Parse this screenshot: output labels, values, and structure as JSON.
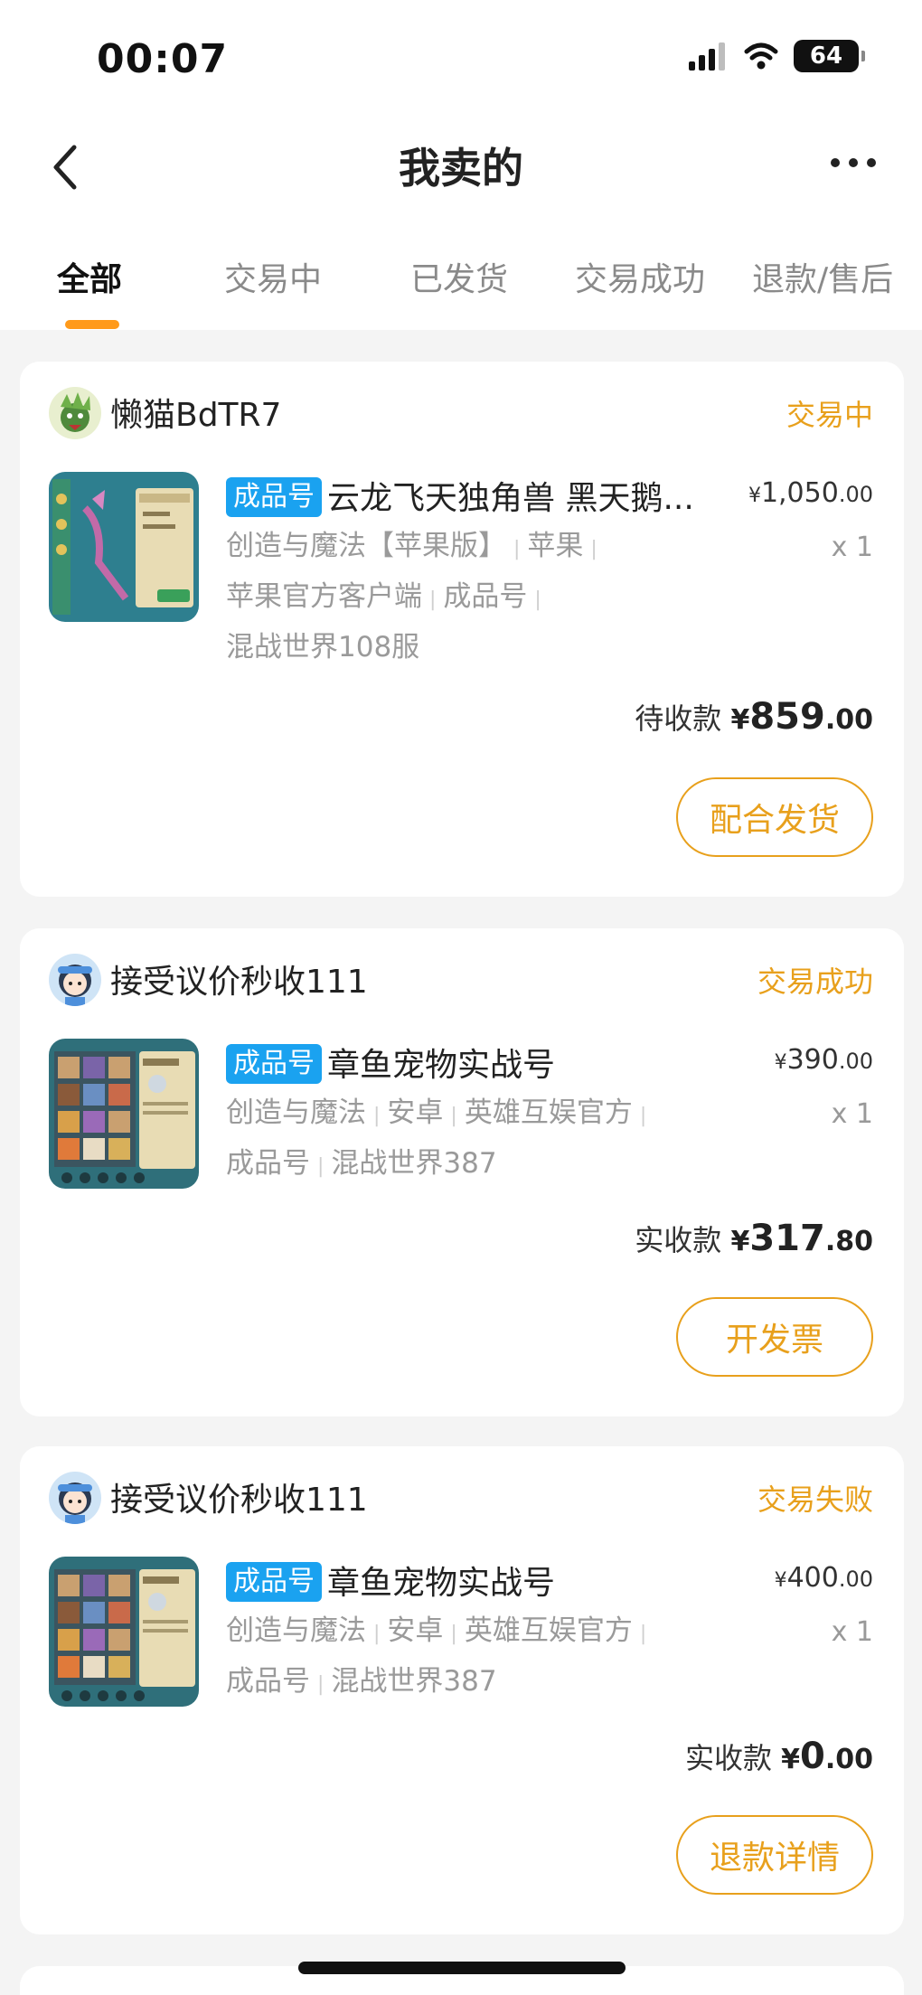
{
  "status_bar": {
    "time": "00:07",
    "battery": "64"
  },
  "nav": {
    "title": "我卖的"
  },
  "tabs": [
    {
      "label": "全部",
      "active": true
    },
    {
      "label": "交易中"
    },
    {
      "label": "已发货"
    },
    {
      "label": "交易成功"
    },
    {
      "label": "退款/售后"
    }
  ],
  "orders": [
    {
      "seller": "懒猫BdTR7",
      "status": "交易中",
      "badge": "成品号",
      "title": "云龙飞天独角兽 黑天鹅...",
      "price": {
        "currency": "¥",
        "int": "1,050",
        "dec": ".00"
      },
      "qty": "x 1",
      "desc": [
        "创造与魔法【苹果版】",
        "苹果",
        "苹果官方客户端",
        "成品号",
        "混战世界108服"
      ],
      "total_label": "待收款",
      "total": {
        "currency": "¥",
        "int": "859",
        "dec": ".00"
      },
      "action": "配合发货"
    },
    {
      "seller": "接受议价秒收111",
      "status": "交易成功",
      "badge": "成品号",
      "title": "章鱼宠物实战号",
      "price": {
        "currency": "¥",
        "int": "390",
        "dec": ".00"
      },
      "qty": "x 1",
      "desc": [
        "创造与魔法",
        "安卓",
        "英雄互娱官方",
        "成品号",
        "混战世界387"
      ],
      "total_label": "实收款",
      "total": {
        "currency": "¥",
        "int": "317",
        "dec": ".80"
      },
      "action": "开发票"
    },
    {
      "seller": "接受议价秒收111",
      "status": "交易失败",
      "badge": "成品号",
      "title": "章鱼宠物实战号",
      "price": {
        "currency": "¥",
        "int": "400",
        "dec": ".00"
      },
      "qty": "x 1",
      "desc": [
        "创造与魔法",
        "安卓",
        "英雄互娱官方",
        "成品号",
        "混战世界387"
      ],
      "total_label": "实收款",
      "total": {
        "currency": "¥",
        "int": "0",
        "dec": ".00"
      },
      "action": "退款详情"
    }
  ],
  "colors": {
    "accent": "#e8a01c",
    "tab_indicator": "#ff9a1a",
    "badge": "#1aa2f0",
    "background": "#f4f4f4"
  },
  "icons": [
    "signal-icon",
    "wifi-icon",
    "battery-icon",
    "back-arrow-icon",
    "more-icon"
  ]
}
